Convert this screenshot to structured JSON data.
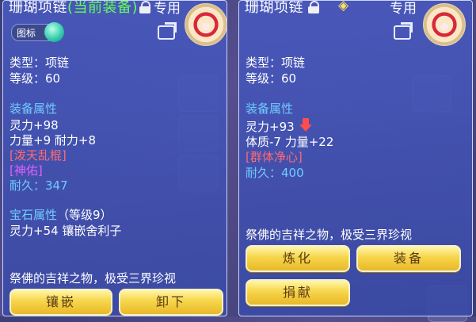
{
  "left_panel": {
    "title": "珊瑚项链",
    "current_tag": "(当前装备)",
    "exclusive_label": "专用",
    "icon_toggle_label": "图标",
    "type": "类型：项链",
    "level": "等级：60",
    "equip_attr_header": "装备属性",
    "attr_line1": "灵力+98",
    "attr_line2": "力量+9 耐力+8",
    "special_skill": "[泼天乱棍]",
    "special_effect": "[神佑]",
    "durability_label": "耐久：",
    "durability_value": "347",
    "gem_header": "宝石属性",
    "gem_level": "（等级9）",
    "gem_line": "灵力+54 镶嵌舍利子",
    "description": "祭佛的吉祥之物，极受三界珍视",
    "buttons": [
      "镶嵌",
      "卸下"
    ]
  },
  "right_panel": {
    "title": "珊瑚项链",
    "exclusive_label": "专用",
    "type": "类型：项链",
    "level": "等级：60",
    "equip_attr_header": "装备属性",
    "attr_line1": "灵力+93",
    "attr_line2": "体质-7 力量+22",
    "special_skill": "[群体净心]",
    "durability_label": "耐久：",
    "durability_value": "400",
    "description": "祭佛的吉祥之物，极受三界珍视",
    "buttons": [
      "炼化",
      "装备",
      "捐献"
    ]
  },
  "icons": [
    "lock-icon",
    "exclamation-icon",
    "necklace-icon",
    "share-icon",
    "down-arrow-icon"
  ],
  "colors": {
    "current_equipped": "#62ff5a",
    "attr_blue": "#71ccff",
    "special_red": "#ff6a73",
    "special_magenta": "#e25fff",
    "button_gold": "#f7d54a"
  }
}
